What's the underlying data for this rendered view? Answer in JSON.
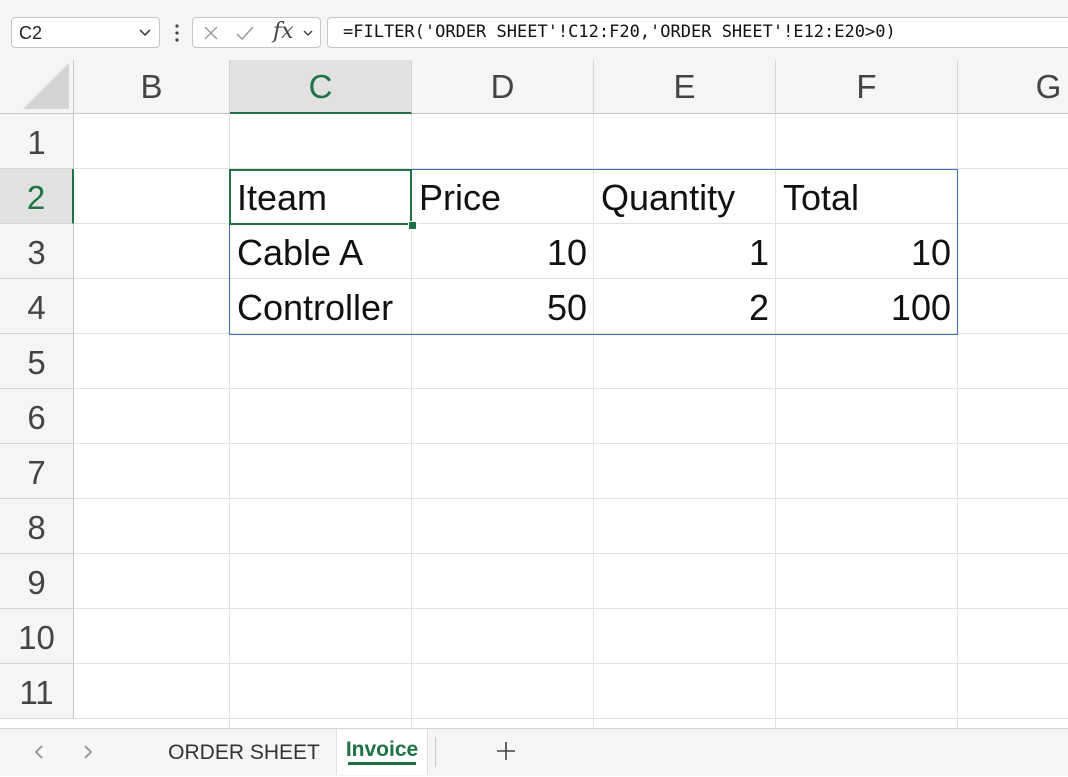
{
  "formula_bar": {
    "name_box": "C2",
    "formula": "=FILTER('ORDER SHEET'!C12:F20,'ORDER SHEET'!E12:E20>0)",
    "fx_label": "fx"
  },
  "grid": {
    "columns": [
      "B",
      "C",
      "D",
      "E",
      "F",
      "G"
    ],
    "rows": [
      "1",
      "2",
      "3",
      "4",
      "5",
      "6",
      "7",
      "8",
      "9",
      "10",
      "11"
    ],
    "selected_column": "C",
    "selected_row": "2",
    "cells": {
      "c2": "Iteam",
      "d2": "Price",
      "e2": "Quantity",
      "f2": "Total",
      "c3": "Cable A",
      "d3": "10",
      "e3": "1",
      "f3": "10",
      "c4": "Controller",
      "d4": "50",
      "e4": "2",
      "f4": "100"
    }
  },
  "sheet_tabs": {
    "tabs": [
      "ORDER SHEET",
      "Invoice"
    ],
    "active": "Invoice"
  },
  "colors": {
    "accent_green": "#1f7244",
    "spill_border_blue": "#3b6fb6",
    "header_bg": "#f5f5f5"
  },
  "icons": [
    "chevron-down-icon",
    "more-vertical-icon",
    "cancel-icon",
    "enter-check-icon",
    "function-icon",
    "chevron-left-icon",
    "chevron-right-icon",
    "plus-icon"
  ]
}
